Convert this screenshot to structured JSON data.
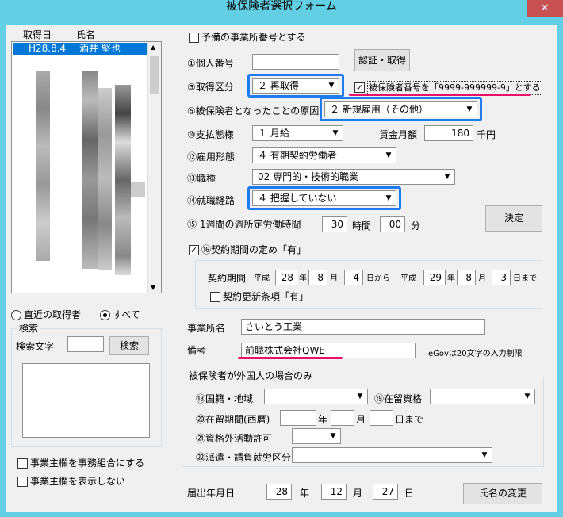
{
  "window": {
    "title": "被保険者選択フォーム",
    "close_glyph": "✕"
  },
  "list": {
    "header_date": "取得日",
    "header_name": "氏名",
    "selected_date": "H28.8.4",
    "selected_name": "酒井 堅也"
  },
  "filter": {
    "recent_label": "直近の取得者",
    "all_label": "すべて",
    "selected": "all"
  },
  "search": {
    "group_label": "検索",
    "text_label": "検索文字",
    "value": "",
    "button": "検索"
  },
  "bottom_left": {
    "cb1_label": "事業主欄を事務組合にする",
    "cb1_checked": false,
    "cb2_label": "事業主欄を表示しない",
    "cb2_checked": false
  },
  "form": {
    "spare_office_label": "予備の事業所番号とする",
    "spare_office_checked": false,
    "personal_number_label": "①個人番号",
    "personal_number_value": "",
    "auth_button": "認証・取得",
    "acq_type_label": "③取得区分",
    "acq_type_value": "２ 再取得",
    "insured_format_label": "被保険者番号を「9999-999999-9」とする",
    "insured_format_checked": true,
    "cause_label": "⑤被保険者となったことの原因",
    "cause_value": "２ 新規雇用（その他）",
    "pay_label": "⑩支払態様",
    "pay_value": "１ 月給",
    "wage_label": "賃金月額",
    "wage_value": "180",
    "wage_unit": "千円",
    "emp_label": "⑫雇用形態",
    "emp_value": "４ 有期契約労働者",
    "job_label": "⑬職種",
    "job_value": "02 専門的・技術的職業",
    "route_label": "⑭就職経路",
    "route_value": "４ 把握していない",
    "hours_label": "⑮ 1週間の週所定労働時間",
    "hours_value": "30",
    "hours_unit": "時間",
    "minutes_value": "00",
    "minutes_unit": "分",
    "decide_button": "決定",
    "contract_label": "⑯契約期間の定め「有」",
    "contract_checked": true,
    "period_label": "契約期間",
    "era1": "平成",
    "from_y": "28",
    "from_m": "8",
    "from_d": "4",
    "from_suffix": "日から",
    "era2": "平成",
    "to_y": "29",
    "to_m": "8",
    "to_d": "3",
    "to_suffix": "日まで",
    "unit_year": "年",
    "unit_month": "月",
    "renew_label": "契約更新条項「有」",
    "renew_checked": false,
    "office_label": "事業所名",
    "office_value": "さいとう工業",
    "note_label": "備考",
    "note_value": "前職株式会社QWE",
    "egov_note": "eGovは20文字の入力制限",
    "foreign_group_label": "被保険者が外国人の場合のみ",
    "nationality_label": "⑱国籍・地域",
    "nationality_value": "",
    "status_label": "⑲在留資格",
    "status_value": "",
    "stay_label": "⑳在留期間(西暦)",
    "stay_year": "",
    "stay_year_unit": "年",
    "stay_month": "",
    "stay_month_unit": "月",
    "stay_day": "",
    "stay_day_unit": "日まで",
    "permit_label": "㉑資格外活動許可",
    "permit_value": "",
    "dispatch_label": "㉒派遣・請負就労区分",
    "dispatch_value": "",
    "filing_label": "届出年月日",
    "filing_y": "28",
    "filing_y_unit": "年",
    "filing_m": "12",
    "filing_m_unit": "月",
    "filing_d": "27",
    "filing_d_unit": "日",
    "rename_button": "氏名の変更"
  },
  "colors": {
    "highlight_blue": "#1e7cf0",
    "highlight_red": "#e8106a",
    "title_bar": "#62cfe4",
    "selection": "#0078d7"
  }
}
